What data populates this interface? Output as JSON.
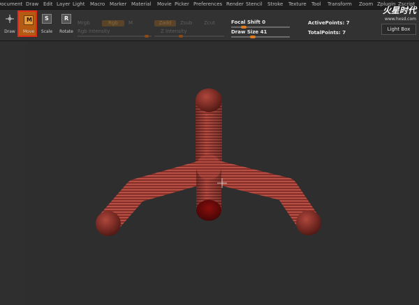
{
  "menu": [
    "Document",
    "Draw",
    "Edit",
    "Layer",
    "Light",
    "Macro",
    "Marker",
    "Material",
    "Movie",
    "Picker",
    "Preferences",
    "Render",
    "Stencil",
    "Stroke",
    "Texture",
    "Tool",
    "Transform",
    "Zoom",
    "Zplugin",
    "Zscript"
  ],
  "toolbar": {
    "draw": "Draw",
    "move": "Move",
    "scale": "Scale",
    "rotate": "Rotate",
    "mrgb": "Mrgb",
    "rgb": "Rgb",
    "m": "M",
    "rgb_intensity": "Rgb Intensity",
    "zadd": "Zadd",
    "zsub": "Zsub",
    "zcut": "Zcut",
    "z_intensity": "Z Intensity",
    "focal_shift": "Focal Shift 0",
    "draw_size": "Draw Size 41",
    "active_points": "ActivePoints: 7",
    "total_points": "TotalPoints: 7",
    "light_box": "Light Box"
  },
  "levels": {
    "focal_shift": 0,
    "draw_size": 41
  },
  "watermark": {
    "title": "火星时代",
    "url": "www.hxsd.com"
  },
  "colors": {
    "accent": "#e07a20",
    "move_active_border": "#e02a1a",
    "model_body": "#9c3a33"
  }
}
